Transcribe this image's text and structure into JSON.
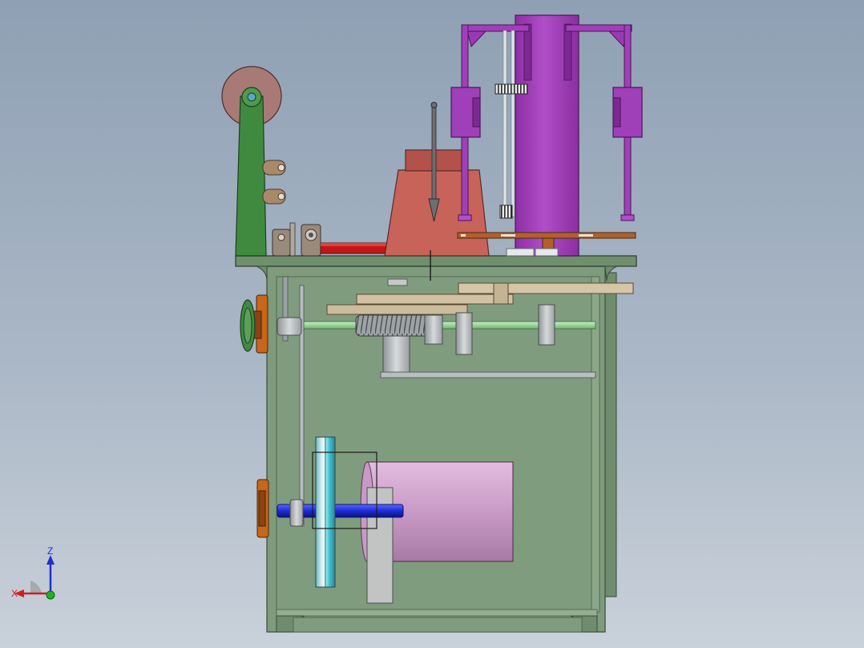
{
  "viewport": {
    "background_top": "#8fa0b4",
    "background_bottom": "#c9d1da"
  },
  "model": {
    "frame_color": "#7d9a7a",
    "lever_color": "#3f8a3f",
    "head_color": "#c8635a",
    "column_color": "#a040b8",
    "motor_color": "#d4a8d0",
    "shaft_color": "#1d2bd6",
    "flange_color": "#c8661a"
  },
  "triad": {
    "z_label": "Z",
    "x_label": "X",
    "z_color": "#1f2fd0",
    "x_color": "#d01f1f",
    "origin_color": "#22b022"
  }
}
